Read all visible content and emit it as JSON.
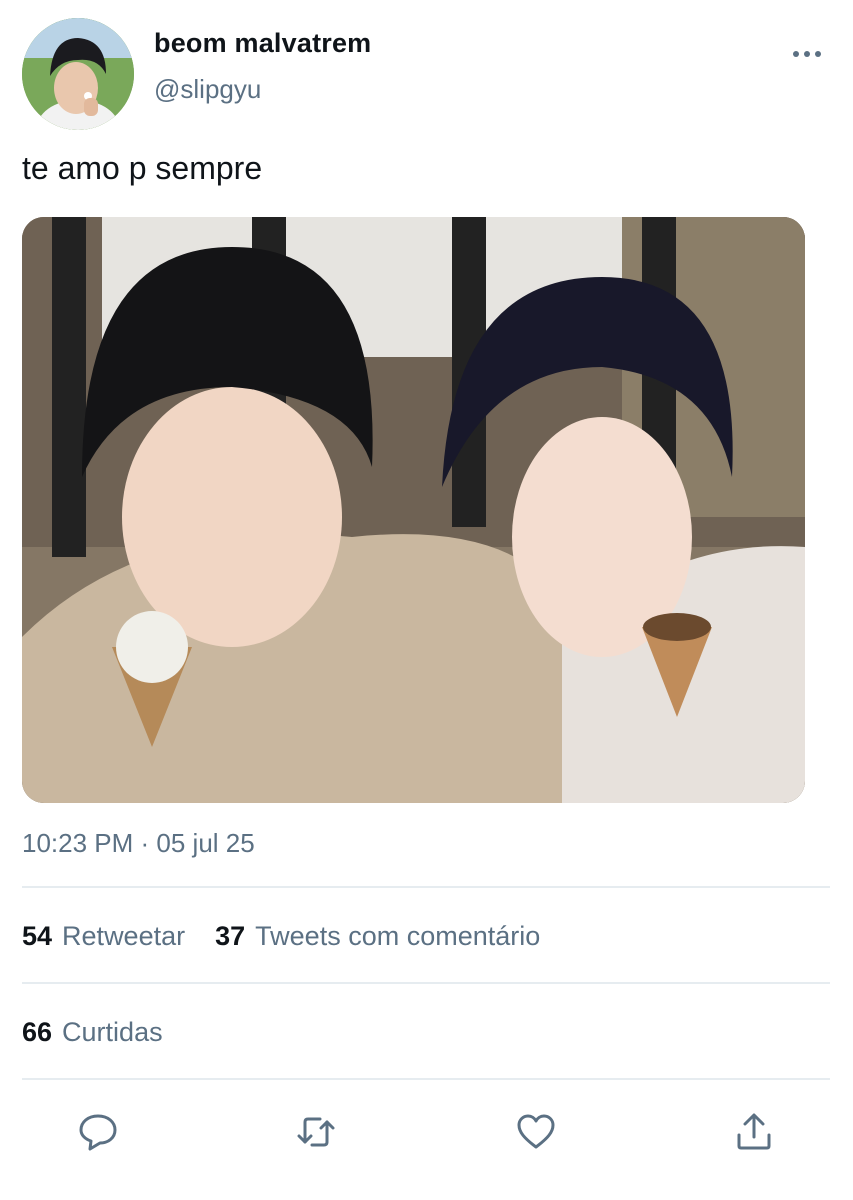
{
  "tweet": {
    "author": {
      "display_name": "beom malvatrem",
      "handle": "@slipgyu",
      "avatar_icon": "profile-photo"
    },
    "text": "te amo p sempre",
    "media_icon": "photo",
    "timestamp": "10:23 PM · 05 jul 25"
  },
  "stats": {
    "retweets": {
      "count": "54",
      "label": "Retweetar"
    },
    "quote_tweets": {
      "count": "37",
      "label": "Tweets com comentário"
    },
    "likes": {
      "count": "66",
      "label": "Curtidas"
    }
  },
  "icons": {
    "more": "more-options-icon",
    "reply": "reply-icon",
    "retweet": "retweet-icon",
    "like": "heart-icon",
    "share": "share-icon"
  },
  "colors": {
    "text_primary": "#0f1419",
    "text_secondary": "#5b7083",
    "divider": "#e6ecf0"
  }
}
